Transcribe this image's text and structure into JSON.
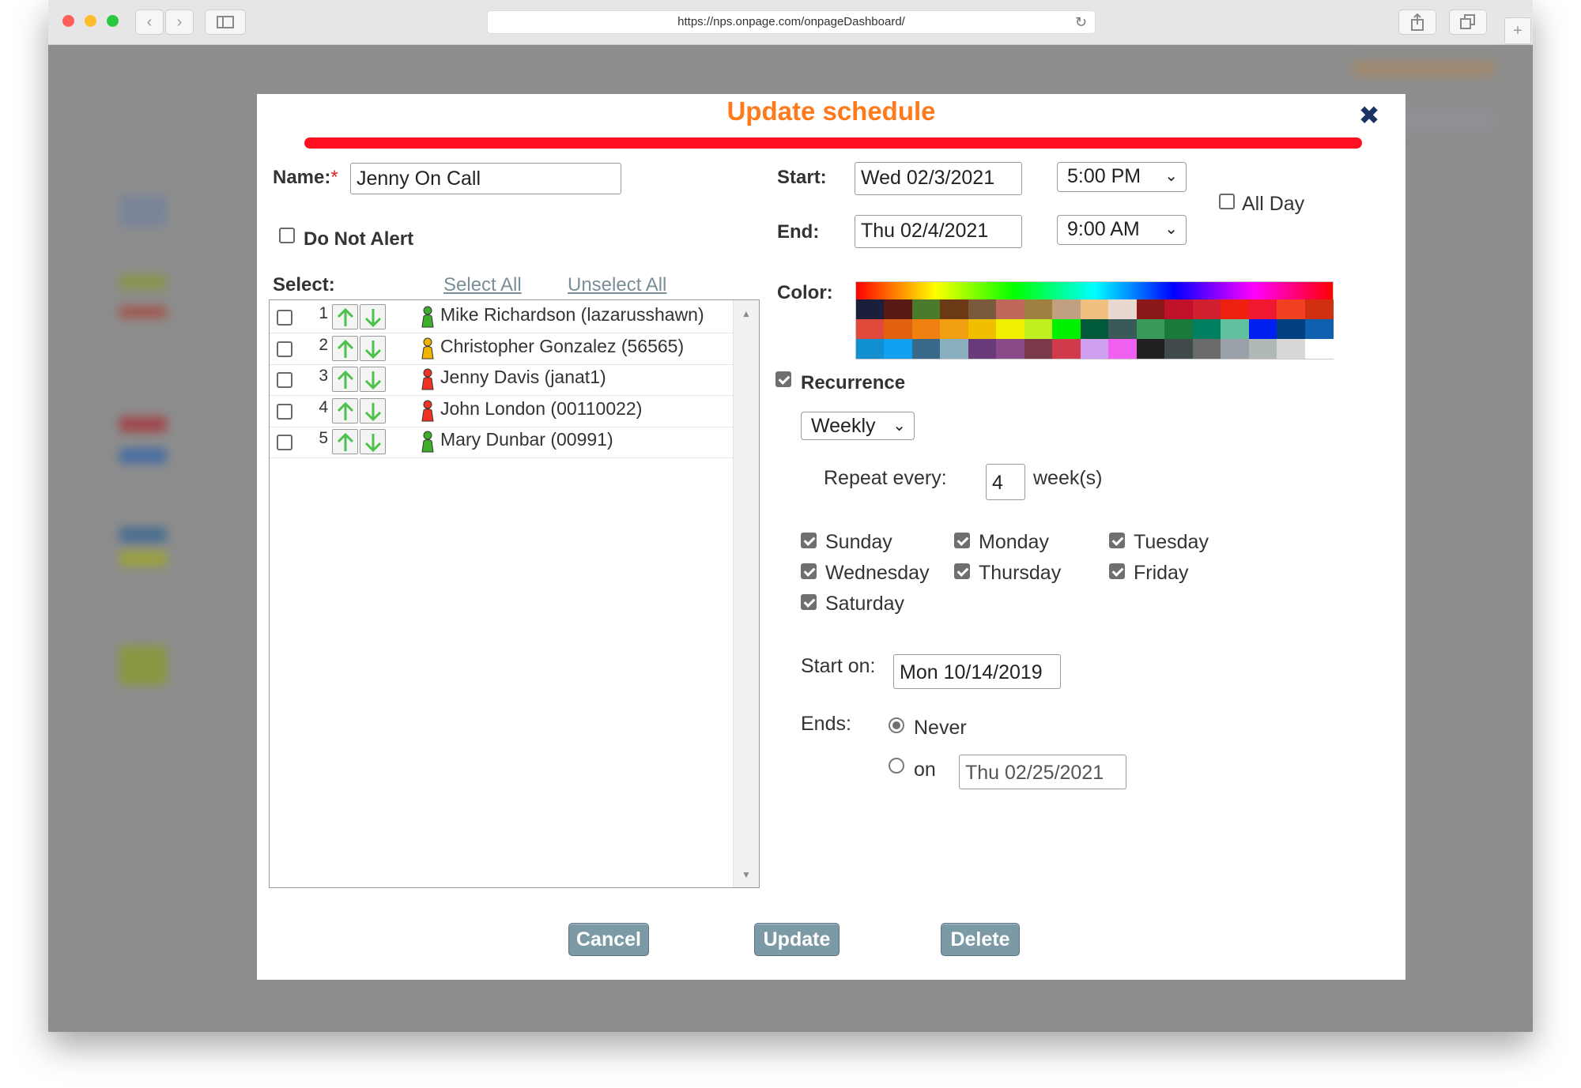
{
  "browser": {
    "url": "https://nps.onpage.com/onpageDashboard/",
    "traffic_lights": [
      "#fe5f57",
      "#febc2e",
      "#28c840"
    ]
  },
  "dialog": {
    "title": "Update schedule",
    "close_icon": "close-icon",
    "name_label": "Name:",
    "required_mark": "*",
    "name_value": "Jenny On Call",
    "do_not_alert_label": "Do Not Alert",
    "do_not_alert_checked": false,
    "select_label": "Select:",
    "select_all": "Select All",
    "unselect_all": "Unselect All",
    "recipients": [
      {
        "num": "1",
        "name": "Mike Richardson (lazarusshawn)",
        "status_color": "#3fae2a",
        "checked": false
      },
      {
        "num": "2",
        "name": "Christopher Gonzalez (56565)",
        "status_color": "#f0b400",
        "checked": false
      },
      {
        "num": "3",
        "name": "Jenny Davis (janat1)",
        "status_color": "#ee3322",
        "checked": false
      },
      {
        "num": "4",
        "name": "John London (00110022)",
        "status_color": "#ee3322",
        "checked": false
      },
      {
        "num": "5",
        "name": "Mary Dunbar (00991)",
        "status_color": "#3fae2a",
        "checked": false
      }
    ],
    "start_label": "Start:",
    "start_date": "Wed 02/3/2021",
    "start_time": "5:00 PM",
    "end_label": "End:",
    "end_date": "Thu 02/4/2021",
    "end_time": "9:00 AM",
    "all_day_label": "All Day",
    "all_day_checked": false,
    "color_label": "Color:",
    "palette_colors": [
      "#1b1f3b",
      "#5a1a14",
      "#4a7a2a",
      "#6b3a12",
      "#7a5a3a",
      "#c0685a",
      "#a08040",
      "#c0a080",
      "#f0c080",
      "#e8d8d0",
      "#8a1818",
      "#c0102a",
      "#d02030",
      "#ee2010",
      "#f01830",
      "#f04020",
      "#d03010",
      "#e04a3a",
      "#e06010",
      "#f08010",
      "#f0a010",
      "#f0c000",
      "#f0f000",
      "#c0f020",
      "#00f000",
      "#005a3a",
      "#3a5a5a",
      "#3a9a5a",
      "#1a7a3a",
      "#008060",
      "#60c0a0",
      "#0020f0",
      "#004080",
      "#1060b0",
      "#1090d0",
      "#10a0f0",
      "#3a6a8a",
      "#8ab0c0",
      "#6a3a7a",
      "#8a4a8a",
      "#7a3a4a",
      "#d03a4a",
      "#d0a0f0",
      "#f060f0",
      "#202020",
      "#404a4a",
      "#6a6a6a",
      "#9aa0a8",
      "#b0b8b8",
      "#d8d8d8",
      "#ffffff"
    ],
    "recurrence_label": "Recurrence",
    "recurrence_checked": true,
    "frequency": "Weekly",
    "repeat_every_label": "Repeat every:",
    "repeat_every_value": "4",
    "repeat_unit": "week(s)",
    "days": [
      {
        "label": "Sunday",
        "checked": true
      },
      {
        "label": "Monday",
        "checked": true
      },
      {
        "label": "Tuesday",
        "checked": true
      },
      {
        "label": "Wednesday",
        "checked": true
      },
      {
        "label": "Thursday",
        "checked": true
      },
      {
        "label": "Friday",
        "checked": true
      },
      {
        "label": "Saturday",
        "checked": true
      }
    ],
    "start_on_label": "Start on:",
    "start_on_value": "Mon 10/14/2019",
    "ends_label": "Ends:",
    "ends_never_label": "Never",
    "ends_on_label": "on",
    "ends_selected": "never",
    "ends_on_value": "Thu 02/25/2021",
    "buttons": {
      "cancel": "Cancel",
      "update": "Update",
      "delete": "Delete"
    }
  }
}
